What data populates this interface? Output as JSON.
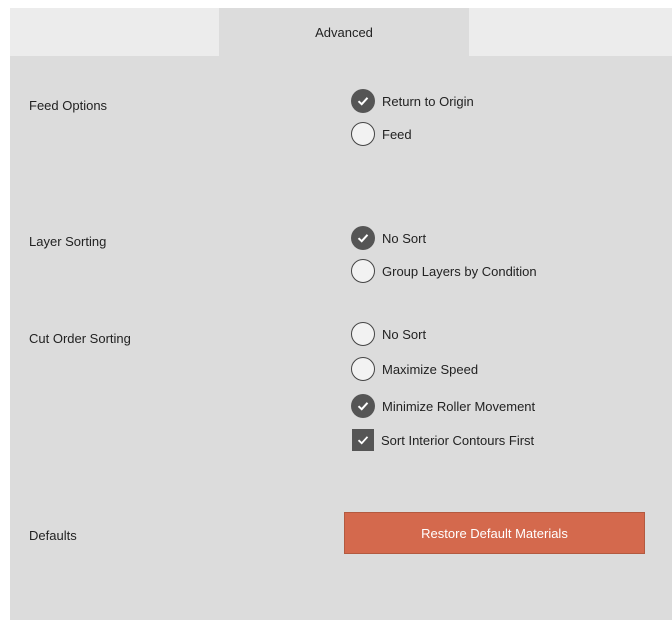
{
  "tabs": {
    "active_label": "Advanced"
  },
  "feed_options": {
    "label": "Feed Options",
    "options": [
      {
        "label": "Return to Origin",
        "selected": true
      },
      {
        "label": "Feed",
        "selected": false
      }
    ]
  },
  "layer_sorting": {
    "label": "Layer Sorting",
    "options": [
      {
        "label": "No Sort",
        "selected": true
      },
      {
        "label": "Group Layers by Condition",
        "selected": false
      }
    ]
  },
  "cut_order_sorting": {
    "label": "Cut Order Sorting",
    "options": [
      {
        "label": "No Sort",
        "selected": false
      },
      {
        "label": "Maximize Speed",
        "selected": false
      },
      {
        "label": "Minimize Roller Movement",
        "selected": true
      }
    ],
    "checkbox": {
      "label": "Sort Interior Contours First",
      "checked": true
    }
  },
  "defaults": {
    "label": "Defaults",
    "button_label": "Restore Default Materials"
  },
  "colors": {
    "panel_bg": "#dcdcdc",
    "tabbar_bg": "#ececec",
    "control_checked": "#555555",
    "button_bg": "#d4694d",
    "button_text": "#ffffff"
  }
}
